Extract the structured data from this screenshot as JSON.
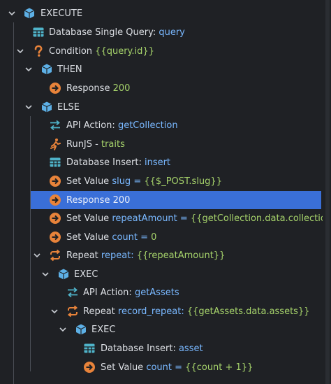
{
  "colors": {
    "background": "#1f2125",
    "selection": "#3a6fd8",
    "label": "#dcdfe4",
    "keyword": "#79b8ff",
    "value": "#a6d36b",
    "orange_icon": "#e8833a",
    "blue_icon": "#5db0e6",
    "teal_icon": "#4fb3c9"
  },
  "tree": {
    "execute": {
      "label": "EXECUTE",
      "icon": "cube-icon"
    },
    "db_query": {
      "label": "Database Single Query: ",
      "name": "query",
      "icon": "table-icon"
    },
    "condition": {
      "label": "Condition ",
      "value": "{{query.id}}",
      "icon": "question-icon"
    },
    "then": {
      "label": "THEN",
      "icon": "cube-icon"
    },
    "then_response": {
      "label": "Response ",
      "value": "200",
      "icon": "arrow-circle-icon"
    },
    "else": {
      "label": "ELSE",
      "icon": "cube-icon"
    },
    "api_action": {
      "label": "API Action: ",
      "name": "getCollection",
      "icon": "swap-icon"
    },
    "runjs": {
      "label": "RunJS - ",
      "value": "traits",
      "icon": "runner-icon"
    },
    "db_insert": {
      "label": "Database Insert: ",
      "name": "insert",
      "icon": "table-icon"
    },
    "set_slug": {
      "label": "Set Value ",
      "name": "slug",
      "eq": " = ",
      "value": "{{$_POST.slug}}",
      "icon": "arrow-circle-icon"
    },
    "else_response": {
      "label": "Response ",
      "value": "200",
      "icon": "arrow-circle-icon"
    },
    "set_repeat_amount": {
      "label": "Set Value ",
      "name": "repeatAmount",
      "eq": " = ",
      "value": "{{getCollection.data.collection.stats.",
      "icon": "arrow-circle-icon"
    },
    "set_count": {
      "label": "Set Value ",
      "name": "count",
      "eq": " = ",
      "value": "0",
      "icon": "arrow-circle-icon"
    },
    "repeat": {
      "label": "Repeat ",
      "name": "repeat",
      "sep": ": ",
      "value": "{{repeatAmount}}",
      "icon": "repeat-icon"
    },
    "exec1": {
      "label": "EXEC",
      "icon": "cube-icon"
    },
    "api_assets": {
      "label": "API Action: ",
      "name": "getAssets",
      "icon": "swap-icon"
    },
    "record_repeat": {
      "label": "Repeat ",
      "name": "record_repeat",
      "sep": ": ",
      "value": "{{getAssets.data.assets}}",
      "icon": "repeat-icon"
    },
    "exec2": {
      "label": "EXEC",
      "icon": "cube-icon"
    },
    "db_insert_asset": {
      "label": "Database Insert: ",
      "name": "asset",
      "icon": "table-icon"
    },
    "set_count_inc": {
      "label": "Set Value ",
      "name": "count",
      "eq": " = ",
      "value": "{{count + 1}}",
      "icon": "arrow-circle-icon"
    }
  }
}
